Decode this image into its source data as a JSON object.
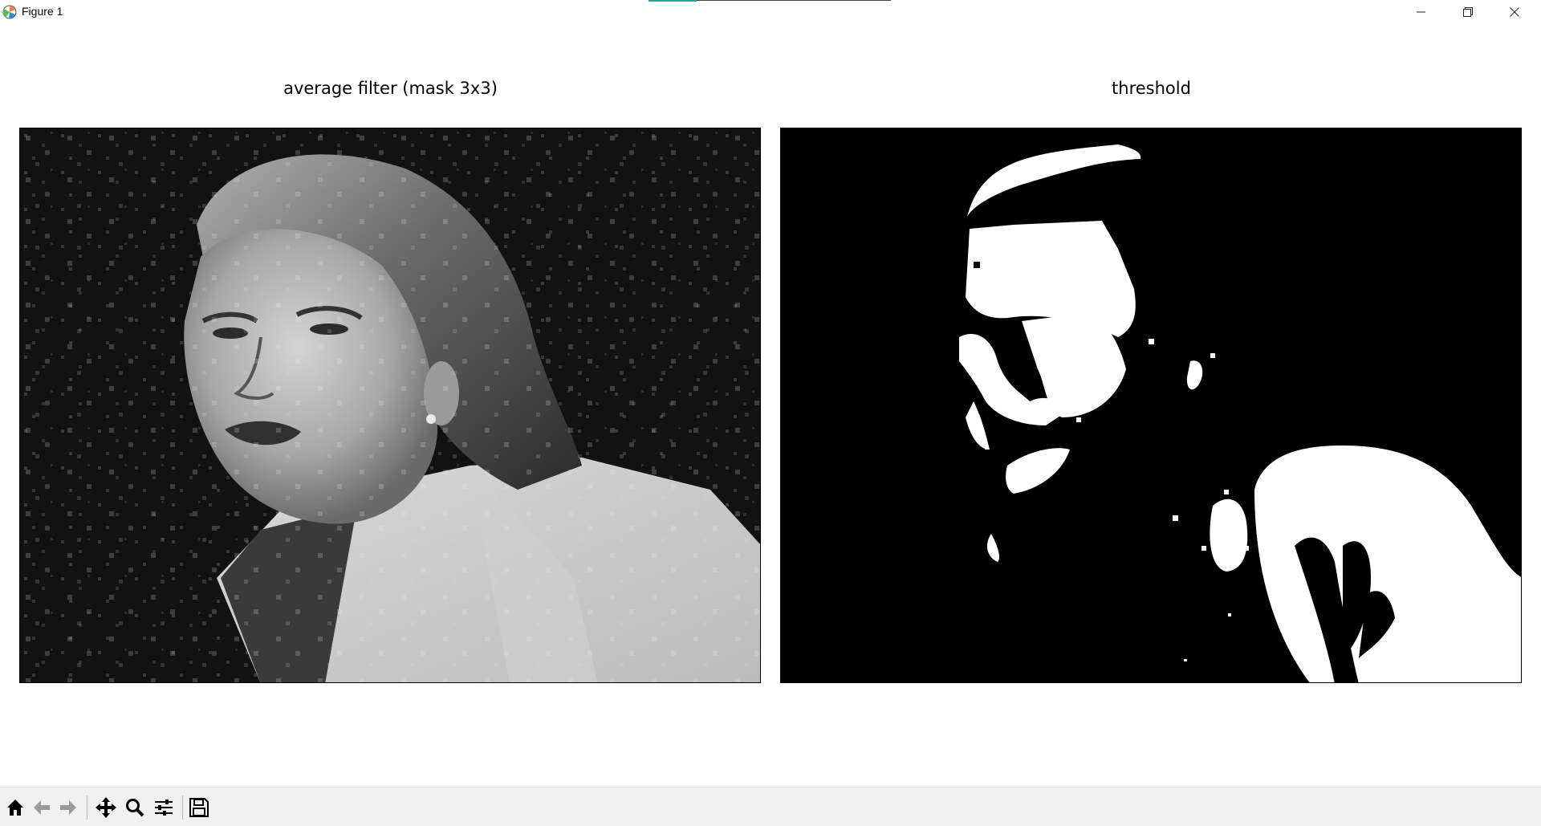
{
  "window": {
    "title": "Figure 1",
    "icons": {
      "app": "matplotlib-logo-icon",
      "minimize": "minimize-icon",
      "maximize": "restore-icon",
      "close": "close-icon"
    }
  },
  "figure": {
    "subplots": [
      {
        "title": "average filter (mask 3x3)",
        "content": "grayscale portrait image, smoothed with 3x3 average filter"
      },
      {
        "title": "threshold",
        "content": "binary thresholded image (black background, white regions)"
      }
    ]
  },
  "toolbar": {
    "tools": [
      {
        "name": "home",
        "icon": "home-icon"
      },
      {
        "name": "back",
        "icon": "arrow-left-icon"
      },
      {
        "name": "forward",
        "icon": "arrow-right-icon"
      },
      {
        "name": "pan",
        "icon": "move-icon"
      },
      {
        "name": "zoom",
        "icon": "magnifier-icon"
      },
      {
        "name": "configure-subplots",
        "icon": "sliders-icon"
      },
      {
        "name": "save",
        "icon": "floppy-disk-icon"
      }
    ]
  },
  "colors": {
    "toolbar_bg": "#f0f0f0",
    "accent": "#2aa198",
    "image_bg": "#000000"
  }
}
